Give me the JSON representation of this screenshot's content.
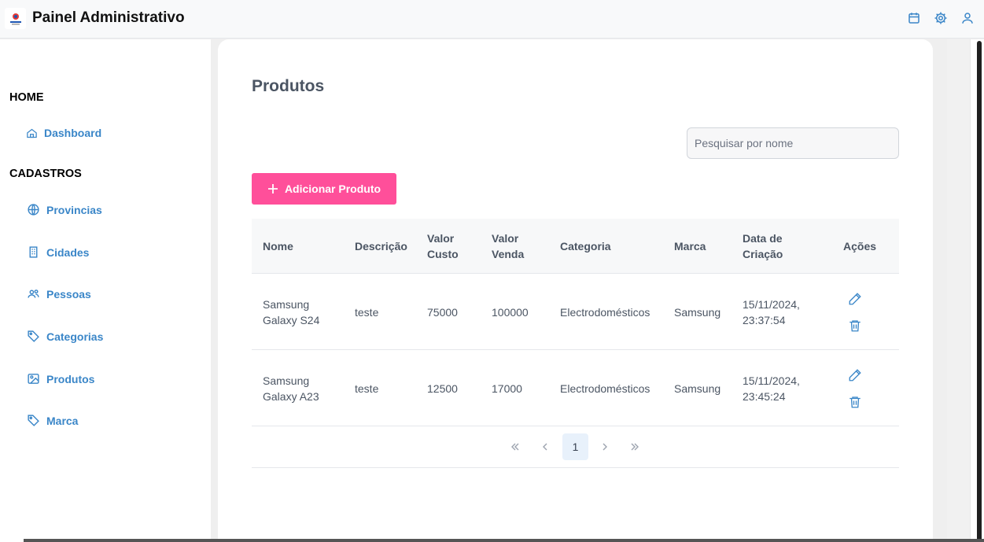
{
  "app": {
    "title": "Painel Administrativo"
  },
  "sidebar": {
    "sections": [
      {
        "title": "HOME",
        "items": [
          {
            "label": "Dashboard",
            "icon": "home-icon"
          }
        ]
      },
      {
        "title": "CADASTROS",
        "items": [
          {
            "label": "Provincias",
            "icon": "globe-icon"
          },
          {
            "label": "Cidades",
            "icon": "building-icon"
          },
          {
            "label": "Pessoas",
            "icon": "users-icon"
          },
          {
            "label": "Categorias",
            "icon": "tag-icon"
          },
          {
            "label": "Produtos",
            "icon": "image-icon"
          },
          {
            "label": "Marca",
            "icon": "tag-icon"
          }
        ]
      }
    ]
  },
  "main": {
    "title": "Produtos",
    "search": {
      "placeholder": "Pesquisar por nome",
      "value": ""
    },
    "add_button": "Adicionar Produto",
    "table": {
      "headers": [
        "Nome",
        "Descrição",
        "Valor Custo",
        "Valor Venda",
        "Categoria",
        "Marca",
        "Data de Criação",
        "Ações"
      ],
      "rows": [
        {
          "nome": "Samsung Galaxy S24",
          "descricao": "teste",
          "valor_custo": "75000",
          "valor_venda": "100000",
          "categoria": "Electrodomésticos",
          "marca": "Samsung",
          "data": "15/11/2024, 23:37:54"
        },
        {
          "nome": "Samsung Galaxy A23",
          "descricao": "teste",
          "valor_custo": "12500",
          "valor_venda": "17000",
          "categoria": "Electrodomésticos",
          "marca": "Samsung",
          "data": "15/11/2024, 23:45:24"
        }
      ]
    },
    "pagination": {
      "current_page": "1"
    }
  },
  "colors": {
    "accent": "#3a86c8",
    "primary_button": "#ff4f9a",
    "active_page_bg": "#e8f1fb"
  }
}
